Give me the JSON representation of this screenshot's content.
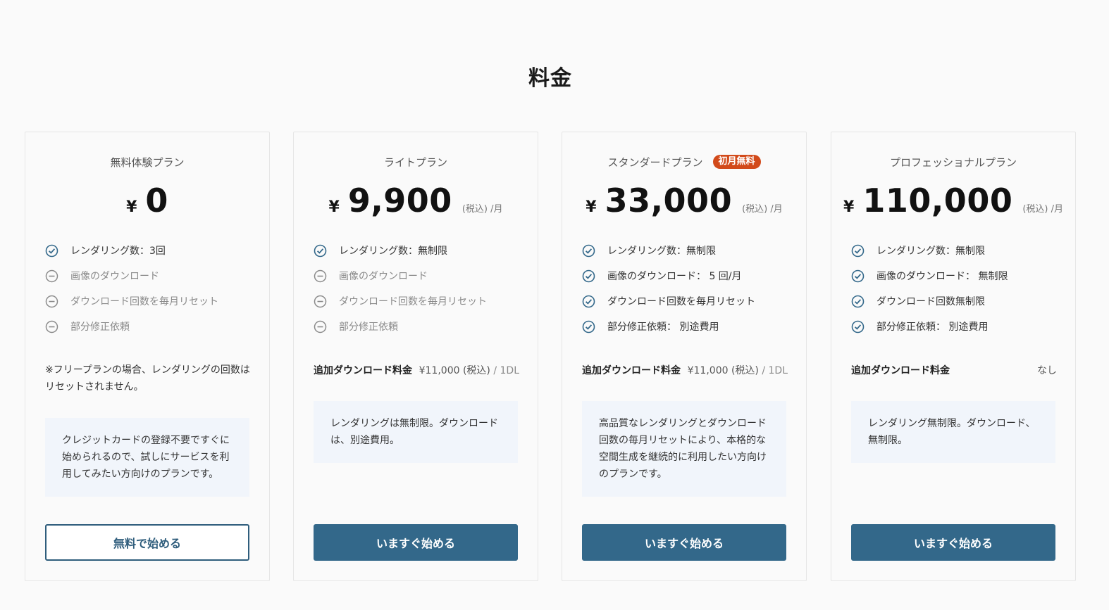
{
  "section": {
    "title": "料金"
  },
  "colors": {
    "accent": "#33688a",
    "badge": "#d24a1a",
    "desc_bg": "#f1f5fb"
  },
  "plans": [
    {
      "name": "無料体験プラン",
      "currency": "¥",
      "price": "0",
      "tax_note": "",
      "features": [
        {
          "text": "レンダリング数：3回",
          "included": true
        },
        {
          "text": "画像のダウンロード",
          "included": false
        },
        {
          "text": "ダウンロード回数を毎月リセット",
          "included": false
        },
        {
          "text": "部分修正依頼",
          "included": false
        }
      ],
      "note": "※フリープランの場合、レンダリングの回数はリセットされません。",
      "description": "クレジットカードの登録不要ですぐに始められるので、試しにサービスを利用してみたい方向けのプランです。",
      "cta": "無料で始める"
    },
    {
      "name": "ライトプラン",
      "currency": "¥",
      "price": "9,900",
      "tax_note": "(税込) /月",
      "features": [
        {
          "text": "レンダリング数：無制限",
          "included": true
        },
        {
          "text": "画像のダウンロード",
          "included": false
        },
        {
          "text": "ダウンロード回数を毎月リセット",
          "included": false
        },
        {
          "text": "部分修正依頼",
          "included": false
        }
      ],
      "addon_label": "追加ダウンロード料金",
      "addon_value": "¥11,000 (税込)",
      "addon_unit": " / 1DL",
      "description": "レンダリングは無制限。ダウンロードは、別途費用。",
      "cta": "いますぐ始める"
    },
    {
      "name": "スタンダードプラン",
      "badge": "初月無料",
      "currency": "¥",
      "price": "33,000",
      "tax_note": "(税込) /月",
      "features": [
        {
          "text": "レンダリング数：無制限",
          "included": true
        },
        {
          "text": "画像のダウンロード： 5 回/月",
          "included": true
        },
        {
          "text": "ダウンロード回数を毎月リセット",
          "included": true
        },
        {
          "text": "部分修正依頼： 別途費用",
          "included": true
        }
      ],
      "addon_label": "追加ダウンロード料金",
      "addon_value": "¥11,000 (税込)",
      "addon_unit": " / 1DL",
      "description": "高品質なレンダリングとダウンロード回数の毎月リセットにより、本格的な空間生成を継続的に利用したい方向けのプランです。",
      "cta": "いますぐ始める"
    },
    {
      "name": "プロフェッショナルプラン",
      "currency": "¥",
      "price": "110,000",
      "tax_note": "(税込) /月",
      "features": [
        {
          "text": "レンダリング数：無制限",
          "included": true
        },
        {
          "text": "画像のダウンロード： 無制限",
          "included": true
        },
        {
          "text": "ダウンロード回数無制限",
          "included": true
        },
        {
          "text": "部分修正依頼： 別途費用",
          "included": true
        }
      ],
      "addon_label": "追加ダウンロード料金",
      "addon_value": "なし",
      "addon_unit": "",
      "description": "レンダリング無制限。ダウンロード、無制限。",
      "cta": "いますぐ始める"
    }
  ]
}
